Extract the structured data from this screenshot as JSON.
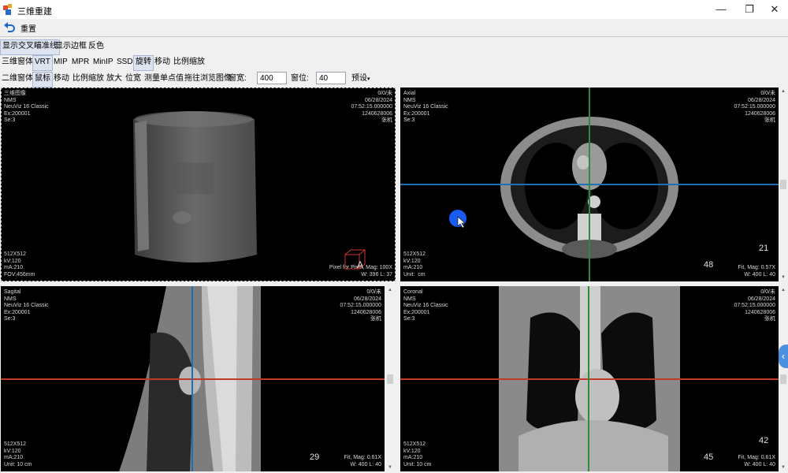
{
  "window": {
    "title": "三维重建",
    "minimize": "—",
    "restore": "❐",
    "close": "✕"
  },
  "toolbar1": {
    "reset_label": "重置"
  },
  "toolbar2": {
    "items": [
      "显示交叉瞄准线",
      "显示边框",
      "反色"
    ]
  },
  "toolbar3": {
    "group_label": "三维窗体",
    "items": [
      "VRT",
      "MIP",
      "MPR",
      "MinIP",
      "SSD",
      "旋转",
      "移动",
      "比例缩放"
    ],
    "active": [
      "VRT",
      "旋转"
    ]
  },
  "toolbar4": {
    "group_label": "二维窗体",
    "items": [
      "鼠标",
      "移动",
      "比例缩放",
      "放大",
      "位宽",
      "测量单点值",
      "拖往浏览图像"
    ],
    "window_width_label": "窗宽:",
    "window_width_value": "400",
    "window_level_label": "窗位:",
    "window_level_value": "40",
    "preset_label": "预设"
  },
  "viewports": [
    {
      "id": "3d",
      "top_left": "三维图像\nNMS\nNeuViz 16 Classic\nEx:200001\nSe:3",
      "top_right": "0/0/未\n06/28/2024\n07:52:15.000000\n1240628006\n张杌",
      "bottom_left": "512X512\nkV:120\nmA:210\nFOV:456mm",
      "bottom_right": "Pixel for Pixel, Mag: 100X\nW: 396 L: 37",
      "slice": "",
      "orientation": "A"
    },
    {
      "id": "axial",
      "top_left": "Axial\nNMS\nNeuViz 16 Classic\nEx:200001\nSe:3",
      "top_right": "0/0/未\n06/28/2024\n07:52:15.000000\n1240628006\n张杌",
      "bottom_left": "512X512\nkV:120\nmA:210\nUnit:  cm",
      "bottom_right": "Fit, Mag: 0.57X\nW: 400 L: 40",
      "slice": "48",
      "side_num": "21"
    },
    {
      "id": "sagittal",
      "top_left": "Sagital\nNMS\nNeuViz 16 Classic\nEx:200001\nSe:3",
      "top_right": "0/0/未\n06/28/2024\n07:52:15.000000\n1240628006\n张杌",
      "bottom_left": "512X512\nkV:120\nmA:210\nUnit: 10 cm",
      "bottom_right": "Fit, Mag: 0.61X\nW: 400 L: 40",
      "slice": "29"
    },
    {
      "id": "coronal",
      "top_left": "Coronal\nNMS\nNeuViz 16 Classic\nEx:200001\nSe:3",
      "top_right": "0/0/未\n06/28/2024\n07:52:15.000000\n1240628006\n张杌",
      "bottom_left": "512X512\nkV:120\nmA:210\nUnit: 10 cm",
      "bottom_right": "Fit, Mag: 0.61X\nW: 400 L: 40",
      "slice": "45",
      "side_num": "42"
    }
  ],
  "colors": {
    "crosshair_red": "#c0392b",
    "crosshair_green": "#2e8b3a",
    "crosshair_blue": "#1f6fb5",
    "accent": "#4a8fe0"
  }
}
